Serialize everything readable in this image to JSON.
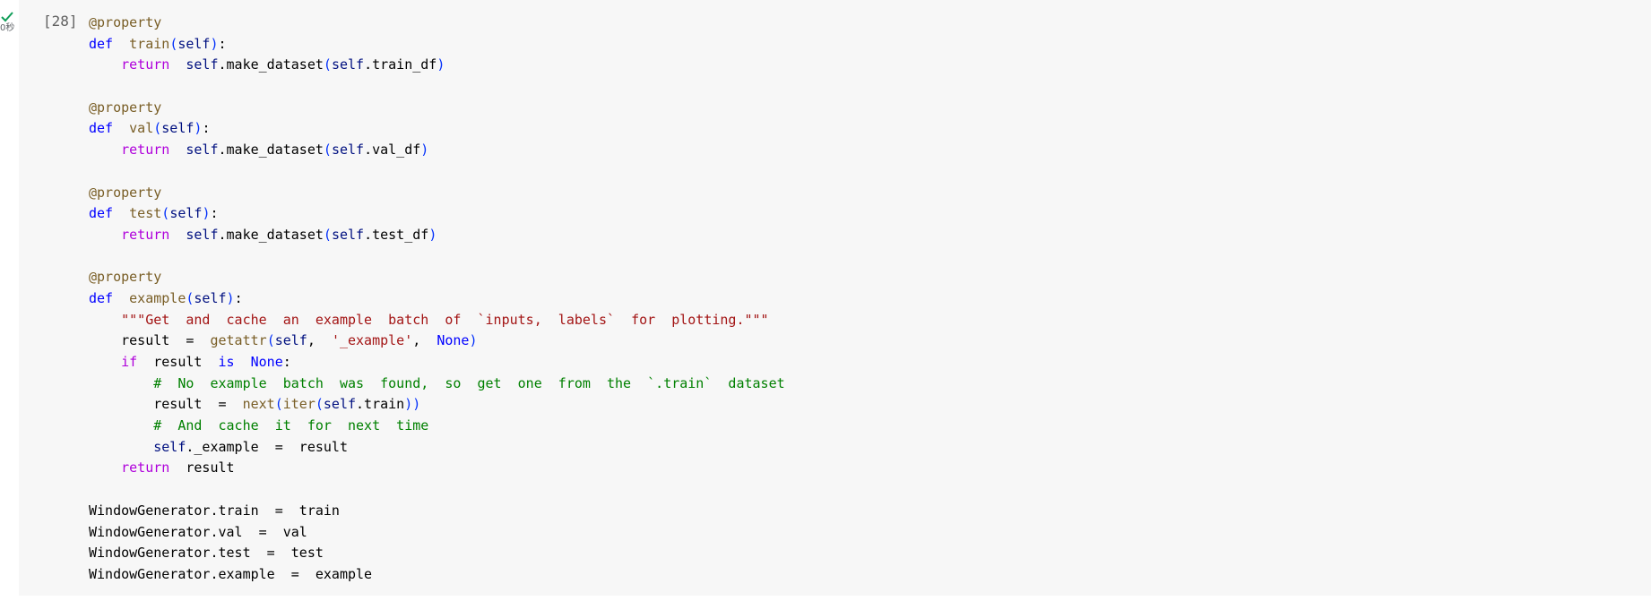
{
  "cell": {
    "execution_count": "[28]",
    "exec_time": "0秒",
    "status_icon": "check-icon",
    "status_color": "#0f9d58"
  },
  "code_lines": [
    [
      {
        "t": "@property",
        "c": "dec"
      }
    ],
    [
      {
        "t": "def",
        "c": "kw"
      },
      {
        "t": "  "
      },
      {
        "t": "train",
        "c": "fn"
      },
      {
        "t": "(",
        "c": "paren"
      },
      {
        "t": "self",
        "c": "self"
      },
      {
        "t": ")",
        "c": "paren"
      },
      {
        "t": ":"
      }
    ],
    [
      {
        "t": "    "
      },
      {
        "t": "return",
        "c": "ctl"
      },
      {
        "t": "  "
      },
      {
        "t": "self",
        "c": "self"
      },
      {
        "t": ".make_dataset"
      },
      {
        "t": "(",
        "c": "paren"
      },
      {
        "t": "self",
        "c": "self"
      },
      {
        "t": ".train_df"
      },
      {
        "t": ")",
        "c": "paren"
      }
    ],
    [],
    [
      {
        "t": "@property",
        "c": "dec"
      }
    ],
    [
      {
        "t": "def",
        "c": "kw"
      },
      {
        "t": "  "
      },
      {
        "t": "val",
        "c": "fn"
      },
      {
        "t": "(",
        "c": "paren"
      },
      {
        "t": "self",
        "c": "self"
      },
      {
        "t": ")",
        "c": "paren"
      },
      {
        "t": ":"
      }
    ],
    [
      {
        "t": "    "
      },
      {
        "t": "return",
        "c": "ctl"
      },
      {
        "t": "  "
      },
      {
        "t": "self",
        "c": "self"
      },
      {
        "t": ".make_dataset"
      },
      {
        "t": "(",
        "c": "paren"
      },
      {
        "t": "self",
        "c": "self"
      },
      {
        "t": ".val_df"
      },
      {
        "t": ")",
        "c": "paren"
      }
    ],
    [],
    [
      {
        "t": "@property",
        "c": "dec"
      }
    ],
    [
      {
        "t": "def",
        "c": "kw"
      },
      {
        "t": "  "
      },
      {
        "t": "test",
        "c": "fn"
      },
      {
        "t": "(",
        "c": "paren"
      },
      {
        "t": "self",
        "c": "self"
      },
      {
        "t": ")",
        "c": "paren"
      },
      {
        "t": ":"
      }
    ],
    [
      {
        "t": "    "
      },
      {
        "t": "return",
        "c": "ctl"
      },
      {
        "t": "  "
      },
      {
        "t": "self",
        "c": "self"
      },
      {
        "t": ".make_dataset"
      },
      {
        "t": "(",
        "c": "paren"
      },
      {
        "t": "self",
        "c": "self"
      },
      {
        "t": ".test_df"
      },
      {
        "t": ")",
        "c": "paren"
      }
    ],
    [],
    [
      {
        "t": "@property",
        "c": "dec"
      }
    ],
    [
      {
        "t": "def",
        "c": "kw"
      },
      {
        "t": "  "
      },
      {
        "t": "example",
        "c": "fn"
      },
      {
        "t": "(",
        "c": "paren"
      },
      {
        "t": "self",
        "c": "self"
      },
      {
        "t": ")",
        "c": "paren"
      },
      {
        "t": ":"
      }
    ],
    [
      {
        "t": "    "
      },
      {
        "t": "\"\"\"Get  and  cache  an  example  batch  of  `inputs,  labels`  for  plotting.\"\"\"",
        "c": "str"
      }
    ],
    [
      {
        "t": "    result  =  "
      },
      {
        "t": "getattr",
        "c": "builtin"
      },
      {
        "t": "(",
        "c": "paren"
      },
      {
        "t": "self",
        "c": "self"
      },
      {
        "t": ",  "
      },
      {
        "t": "'_example'",
        "c": "str"
      },
      {
        "t": ",  "
      },
      {
        "t": "None",
        "c": "const"
      },
      {
        "t": ")",
        "c": "paren"
      }
    ],
    [
      {
        "t": "    "
      },
      {
        "t": "if",
        "c": "ctl"
      },
      {
        "t": "  result  "
      },
      {
        "t": "is",
        "c": "kw"
      },
      {
        "t": "  "
      },
      {
        "t": "None",
        "c": "const"
      },
      {
        "t": ":"
      }
    ],
    [
      {
        "t": "        "
      },
      {
        "t": "#  No  example  batch  was  found,  so  get  one  from  the  `.train`  dataset",
        "c": "cmt"
      }
    ],
    [
      {
        "t": "        result  =  "
      },
      {
        "t": "next",
        "c": "builtin"
      },
      {
        "t": "(",
        "c": "paren"
      },
      {
        "t": "iter",
        "c": "builtin"
      },
      {
        "t": "(",
        "c": "paren"
      },
      {
        "t": "self",
        "c": "self"
      },
      {
        "t": ".train"
      },
      {
        "t": "))",
        "c": "paren"
      }
    ],
    [
      {
        "t": "        "
      },
      {
        "t": "#  And  cache  it  for  next  time",
        "c": "cmt"
      }
    ],
    [
      {
        "t": "        "
      },
      {
        "t": "self",
        "c": "self"
      },
      {
        "t": "._example  =  result"
      }
    ],
    [
      {
        "t": "    "
      },
      {
        "t": "return",
        "c": "ctl"
      },
      {
        "t": "  result"
      }
    ],
    [],
    [
      {
        "t": "WindowGenerator.train  =  train"
      }
    ],
    [
      {
        "t": "WindowGenerator.val  =  val"
      }
    ],
    [
      {
        "t": "WindowGenerator.test  =  test"
      }
    ],
    [
      {
        "t": "WindowGenerator.example  =  example"
      }
    ]
  ]
}
